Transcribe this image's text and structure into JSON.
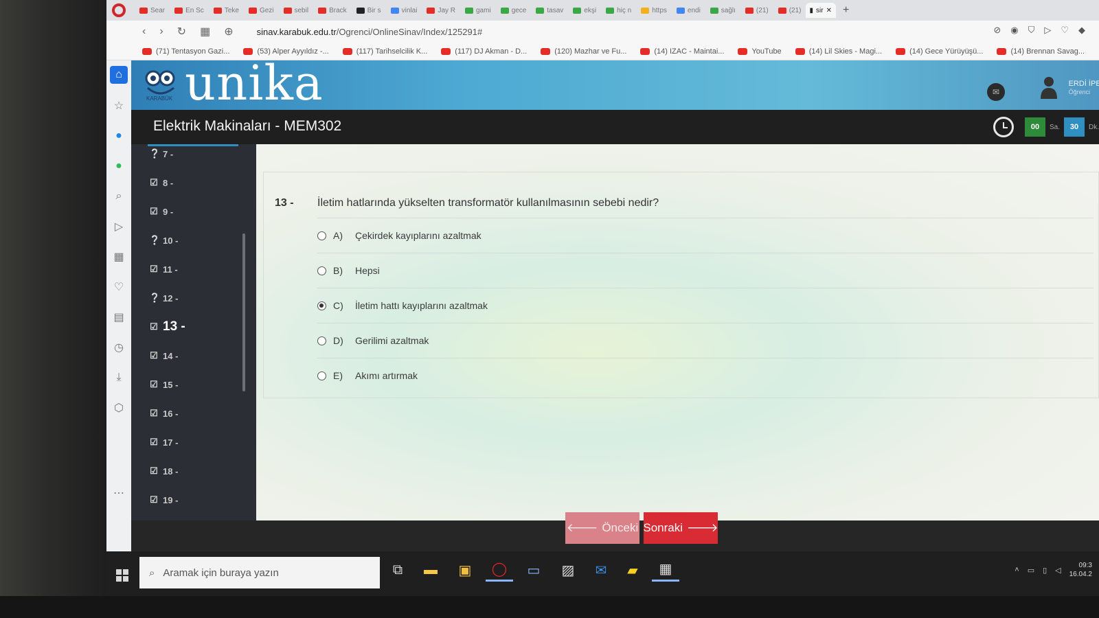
{
  "browser": {
    "tabs": [
      {
        "label": "Sear",
        "color": "#e52d27"
      },
      {
        "label": "En Sc",
        "color": "#e52d27"
      },
      {
        "label": "Teke",
        "color": "#e52d27"
      },
      {
        "label": "Gezi",
        "color": "#e52d27"
      },
      {
        "label": "sebil",
        "color": "#e52d27"
      },
      {
        "label": "Brack",
        "color": "#e52d27"
      },
      {
        "label": "Bir s",
        "color": "#222222"
      },
      {
        "label": "vinlai",
        "color": "#4285f4"
      },
      {
        "label": "Jay R",
        "color": "#e52d27"
      },
      {
        "label": "gami",
        "color": "#3aa845"
      },
      {
        "label": "gece",
        "color": "#3aa845"
      },
      {
        "label": "tasav",
        "color": "#3aa845"
      },
      {
        "label": "ekşi",
        "color": "#3aa845"
      },
      {
        "label": "hiç n",
        "color": "#3aa845"
      },
      {
        "label": "https",
        "color": "#f2b01e"
      },
      {
        "label": "endi",
        "color": "#4285f4"
      },
      {
        "label": "sağlı",
        "color": "#3aa845"
      },
      {
        "label": "(21)",
        "color": "#e52d27"
      },
      {
        "label": "(21)",
        "color": "#e52d27"
      }
    ],
    "active_tab": "sir",
    "url_host": "sinav.karabuk.edu.tr",
    "url_path": "/Ogrenci/OnlineSinav/Index/125291#",
    "bookmarks": [
      "(71) Tentasyon Gazi...",
      "(53) Alper Ayyıldız -...",
      "(117) Tarihselcilik K...",
      "(117) DJ Akman - D...",
      "(120) Mazhar ve Fu...",
      "(14) IZAC - Maintai...",
      "YouTube",
      "(14) Lil Skies - Magi...",
      "(14) Gece Yürüyüşü...",
      "(14) Brennan Savag..."
    ]
  },
  "header": {
    "logo_text": "unika",
    "logo_sub": "KARABÜK",
    "user_name": "ERDİ İPEK",
    "user_role": "Öğrenci"
  },
  "course": {
    "title": "Elektrik Makinaları - MEM302",
    "timer_hours": "00",
    "timer_hours_unit": "Sa.",
    "timer_minutes": "30",
    "timer_minutes_unit": "Dk."
  },
  "question_list": [
    {
      "label": "7 -",
      "status": "unanswered"
    },
    {
      "label": "8 -",
      "status": "answered"
    },
    {
      "label": "9 -",
      "status": "answered"
    },
    {
      "label": "10 -",
      "status": "unanswered"
    },
    {
      "label": "11 -",
      "status": "answered"
    },
    {
      "label": "12 -",
      "status": "unanswered"
    },
    {
      "label": "13 -",
      "status": "current"
    },
    {
      "label": "14 -",
      "status": "answered"
    },
    {
      "label": "15 -",
      "status": "answered"
    },
    {
      "label": "16 -",
      "status": "answered"
    },
    {
      "label": "17 -",
      "status": "answered"
    },
    {
      "label": "18 -",
      "status": "answered"
    },
    {
      "label": "19 -",
      "status": "answered"
    }
  ],
  "question": {
    "number": "13 -",
    "text": "İletim hatlarında yükselten transformatör kullanılmasının sebebi nedir?",
    "options": [
      {
        "letter": "A)",
        "text": "Çekirdek kayıplarını azaltmak",
        "selected": false
      },
      {
        "letter": "B)",
        "text": "Hepsi",
        "selected": false
      },
      {
        "letter": "C)",
        "text": "İletim hattı kayıplarını azaltmak",
        "selected": true
      },
      {
        "letter": "D)",
        "text": "Gerilimi azaltmak",
        "selected": false
      },
      {
        "letter": "E)",
        "text": "Akımı artırmak",
        "selected": false
      }
    ]
  },
  "nav": {
    "prev_label": "Önceki",
    "next_label": "Sonraki"
  },
  "taskbar": {
    "search_placeholder": "Aramak için buraya yazın",
    "time": "09:3",
    "date": "16.04.2"
  }
}
